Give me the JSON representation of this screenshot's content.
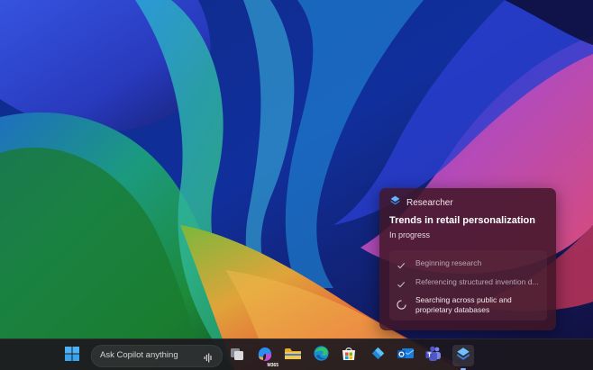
{
  "researcher": {
    "app_name": "Researcher",
    "title": "Trends in retail personalization",
    "status": "In progress",
    "steps": [
      {
        "label": "Beginning research",
        "state": "done"
      },
      {
        "label": "Referencing structured invention d...",
        "state": "done"
      },
      {
        "label": "Searching across public and proprietary databases",
        "state": "in-progress"
      }
    ]
  },
  "taskbar": {
    "search_placeholder": "Ask Copilot anything",
    "apps": [
      {
        "name": "Start",
        "icon": "windows-logo-icon"
      },
      {
        "name": "Task View",
        "icon": "task-view-icon"
      },
      {
        "name": "Microsoft 365 Copilot",
        "icon": "m365-icon",
        "badge": "M365"
      },
      {
        "name": "File Explorer",
        "icon": "folder-icon"
      },
      {
        "name": "Microsoft Edge",
        "icon": "edge-icon"
      },
      {
        "name": "Microsoft Store",
        "icon": "store-icon"
      },
      {
        "name": "Azure",
        "icon": "azure-icon"
      },
      {
        "name": "Outlook",
        "icon": "outlook-icon"
      },
      {
        "name": "Teams",
        "icon": "teams-icon"
      },
      {
        "name": "Researcher",
        "icon": "researcher-icon"
      }
    ]
  }
}
